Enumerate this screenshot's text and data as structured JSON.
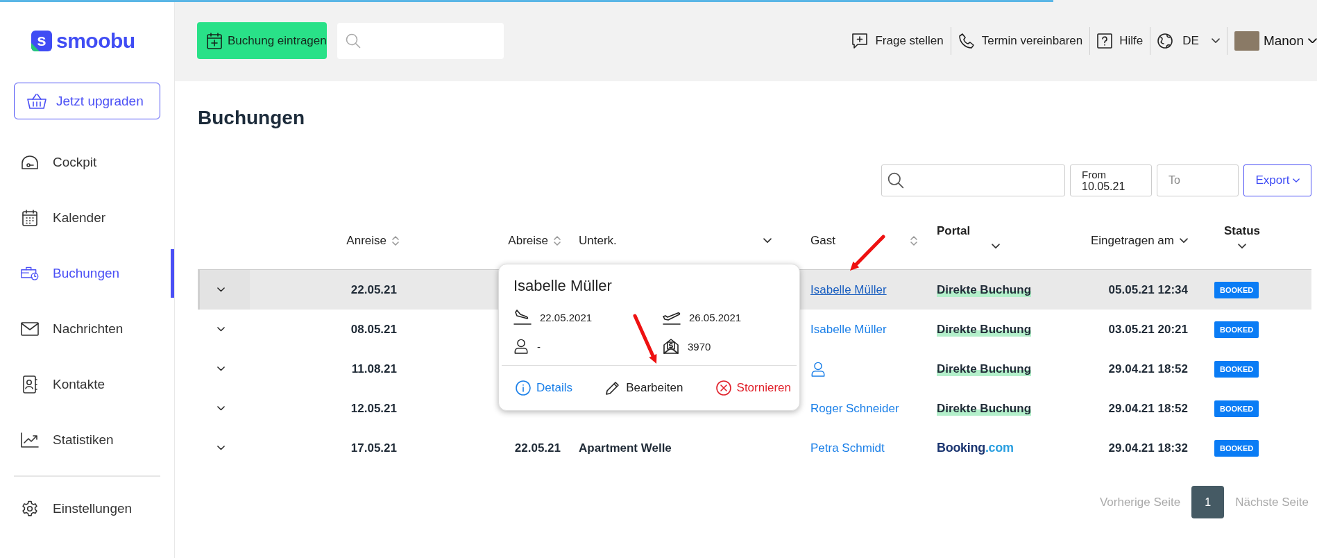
{
  "page_progress": {
    "level": 0.8
  },
  "logo": {
    "mark": "s",
    "text": "smoobu"
  },
  "sidebar": {
    "upgrade_button": "Jetzt upgraden",
    "items": [
      {
        "label": "Cockpit",
        "selected": false
      },
      {
        "label": "Kalender",
        "selected": false
      },
      {
        "label": "Buchungen",
        "selected": true
      },
      {
        "label": "Nachrichten",
        "selected": false
      },
      {
        "label": "Kontakte",
        "selected": false
      },
      {
        "label": "Statistiken",
        "selected": false
      }
    ],
    "footer_items": [
      {
        "label": "Einstellungen",
        "selected": false
      }
    ]
  },
  "topbar": {
    "primary_button": "Buchung eintragen",
    "links": [
      {
        "label": "Frage stellen"
      },
      {
        "label": "Termin vereinbaren"
      },
      {
        "label": "Hilfe"
      }
    ],
    "language": "DE",
    "user": "Manon"
  },
  "page_title": "Buchungen",
  "filters": {
    "from_label": "From",
    "from_value": "10.05.21",
    "to_placeholder": "To",
    "export_button": "Export"
  },
  "table": {
    "columns": [
      {
        "label": "Anreise",
        "kind": "sort"
      },
      {
        "label": "Abreise",
        "kind": "sort"
      },
      {
        "label": "Unterk.",
        "kind": "dropdown"
      },
      {
        "label": "Gast",
        "kind": "sort"
      },
      {
        "label": "Portal",
        "kind": "stacked"
      },
      {
        "label": "Eingetragen am",
        "kind": "dropdown"
      },
      {
        "label": "Status",
        "kind": "stacked"
      }
    ],
    "rows": [
      {
        "selected": true,
        "arrival": "22.05.21",
        "guest": {
          "kind": "name",
          "text": "Isabelle Müller"
        },
        "portal": {
          "kind": "direct",
          "text": "Direkte Buchung"
        },
        "created": "05.05.21 12:34",
        "status": "BOOKED"
      },
      {
        "selected": false,
        "arrival": "08.05.21",
        "guest": {
          "kind": "name",
          "text": "Isabelle Müller"
        },
        "portal": {
          "kind": "direct",
          "text": "Direkte Buchung"
        },
        "created": "03.05.21 20:21",
        "status": "BOOKED"
      },
      {
        "selected": false,
        "arrival": "11.08.21",
        "guest": {
          "kind": "unknown"
        },
        "portal": {
          "kind": "direct",
          "text": "Direkte Buchung"
        },
        "created": "29.04.21 18:52",
        "status": "BOOKED"
      },
      {
        "selected": false,
        "arrival": "12.05.21",
        "guest": {
          "kind": "name",
          "text": "Roger Schneider"
        },
        "portal": {
          "kind": "direct",
          "text": "Direkte Buchung"
        },
        "created": "29.04.21 18:52",
        "status": "BOOKED"
      },
      {
        "selected": false,
        "arrival": "17.05.21",
        "departure": "22.05.21",
        "accommodation": "Apartment Welle",
        "guest": {
          "kind": "name",
          "text": "Petra Schmidt"
        },
        "portal": {
          "kind": "booking",
          "name": "Booking",
          "suffix": ".com"
        },
        "created": "29.04.21 18:32",
        "status": "BOOKED"
      }
    ]
  },
  "popup": {
    "title": "Isabelle Müller",
    "arrival": "22.05.2021",
    "departure": "26.05.2021",
    "guests": "-",
    "price": "3970",
    "actions": [
      {
        "kind": "info",
        "label": "Details"
      },
      {
        "kind": "edit",
        "label": "Bearbeiten"
      },
      {
        "kind": "cancel",
        "label": "Stornieren"
      }
    ]
  },
  "pagination": {
    "previous": "Vorherige Seite",
    "pages": [
      {
        "label": "1",
        "selected": true
      }
    ],
    "next": "Nächste Seite"
  }
}
